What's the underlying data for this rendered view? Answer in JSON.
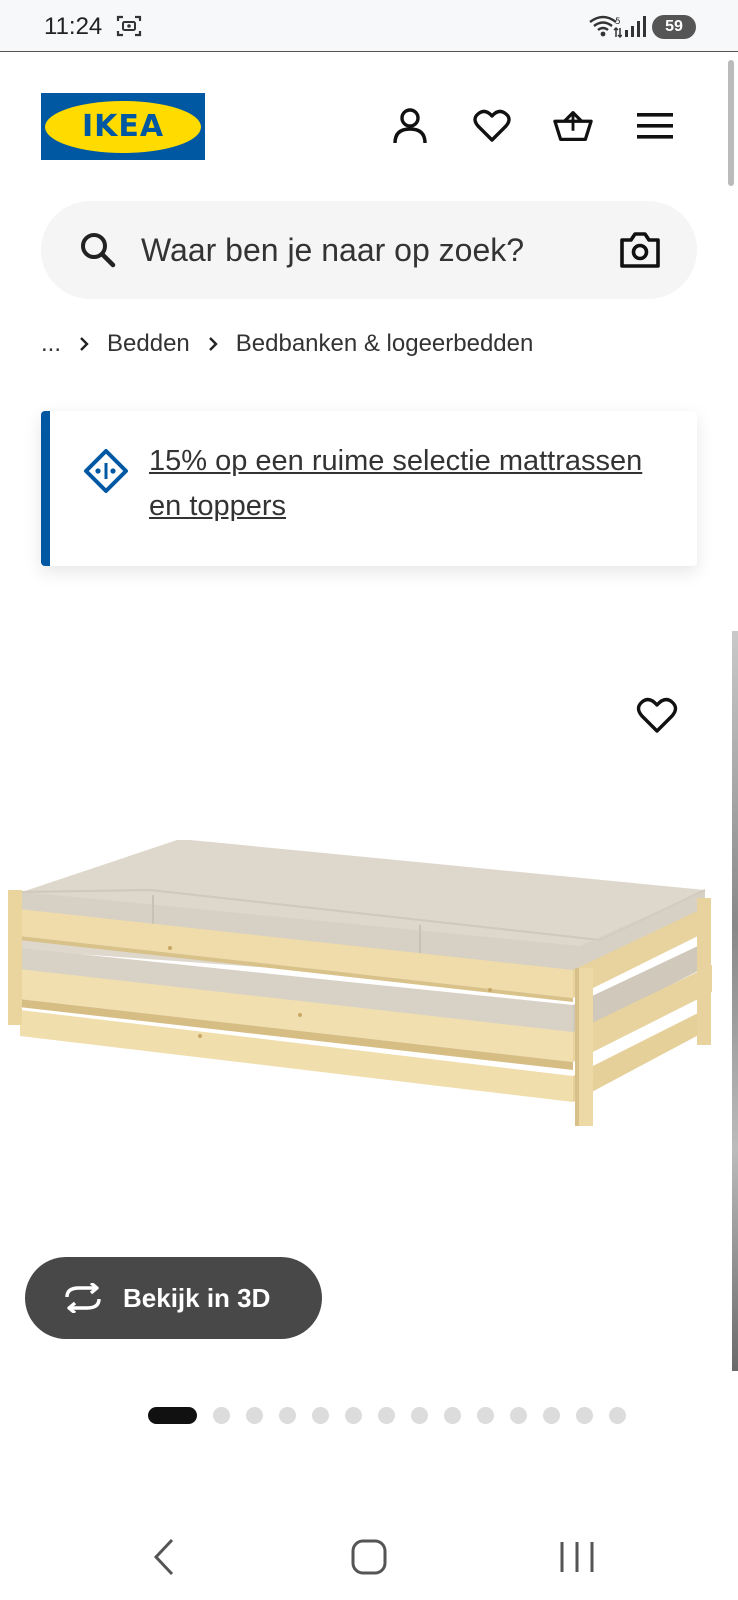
{
  "status_bar": {
    "time": "11:24",
    "battery": "59"
  },
  "header": {
    "logo_text": "IKEA",
    "icons": [
      "account-icon",
      "wishlist-icon",
      "basket-icon",
      "menu-icon"
    ]
  },
  "search": {
    "placeholder": "Waar ben je naar op zoek?"
  },
  "breadcrumb": {
    "ellipsis": "...",
    "items": [
      "Bedden",
      "Bedbanken & logeerbedden"
    ]
  },
  "promo": {
    "text": "15% op een ruime selectie mattrassen en toppers"
  },
  "product_gallery": {
    "view_3d_label": "Bekijk in 3D",
    "total_images": 14,
    "active_index": 0
  },
  "colors": {
    "brand_blue": "#0058a3",
    "brand_yellow": "#ffdb00",
    "button_dark": "#484848"
  }
}
